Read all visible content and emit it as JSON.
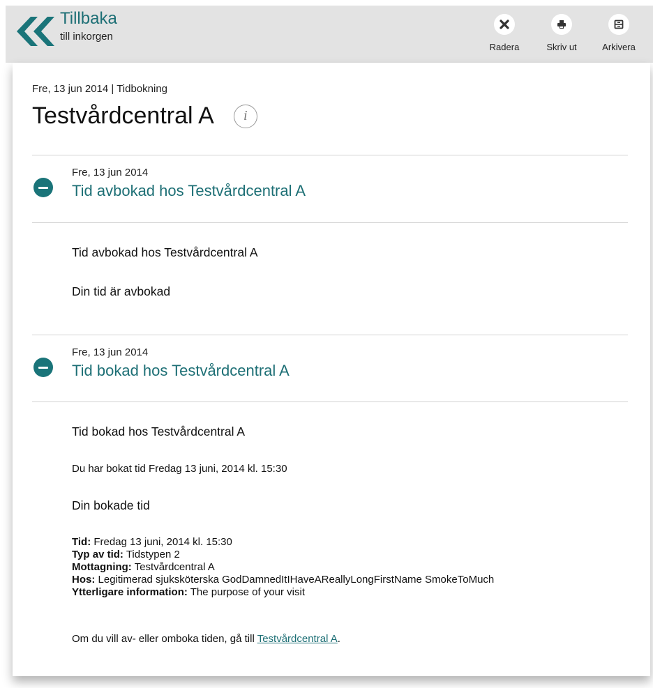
{
  "header": {
    "back_title": "Tillbaka",
    "back_subtitle": "till inkorgen",
    "actions": {
      "delete": "Radera",
      "print": "Skriv ut",
      "archive": "Arkivera"
    }
  },
  "conversation": {
    "meta": "Fre, 13 jun 2014 | Tidbokning",
    "title": "Testvårdcentral A"
  },
  "messages": [
    {
      "date": "Fre, 13 jun 2014",
      "title": "Tid avbokad hos Testvårdcentral A",
      "body_heading": "Tid avbokad hos Testvårdcentral A",
      "body_text": "Din tid är avbokad"
    },
    {
      "date": "Fre, 13 jun 2014",
      "title": "Tid bokad hos Testvårdcentral A",
      "body_heading": "Tid bokad hos Testvårdcentral A",
      "booked_line": "Du har bokat tid Fredag 13 juni, 2014 kl. 15:30",
      "section_title": "Din bokade tid",
      "details": {
        "tid_label": "Tid:",
        "tid_value": "Fredag 13 juni, 2014 kl. 15:30",
        "typ_label": "Typ av tid:",
        "typ_value": "Tidstypen 2",
        "mottagning_label": "Mottagning:",
        "mottagning_value": "Testvårdcentral A",
        "hos_label": "Hos:",
        "hos_value": "Legitimerad sjuksköterska GodDamnedItIHaveAReallyLongFirstName SmokeToMuch",
        "info_label": "Ytterligare information:",
        "info_value": "The purpose of your visit"
      },
      "footer_prefix": "Om du vill av- eller omboka tiden, gå till",
      "footer_link": "Testvårdcentral A",
      "footer_suffix": "."
    }
  ]
}
